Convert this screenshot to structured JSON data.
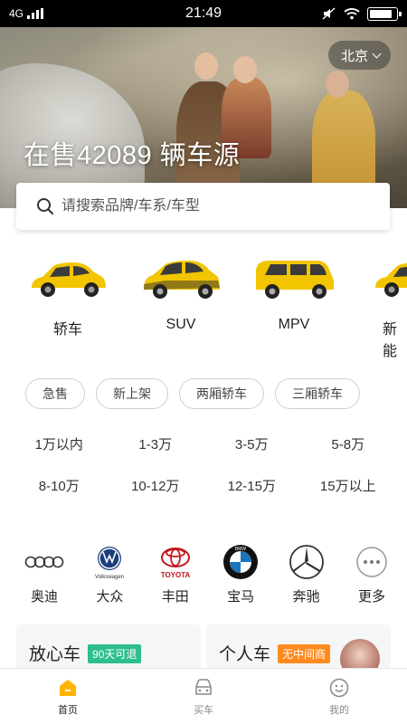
{
  "status_bar": {
    "network": "4G",
    "time": "21:49"
  },
  "hero": {
    "title": "在售42089 辆车源",
    "city": "北京"
  },
  "search": {
    "placeholder": "请搜索品牌/车系/车型"
  },
  "car_types": [
    {
      "label": "轿车",
      "color": "#f2c500"
    },
    {
      "label": "SUV",
      "color": "#f2c500"
    },
    {
      "label": "MPV",
      "color": "#f2c500"
    },
    {
      "label": "新能",
      "color": "#f2c500"
    }
  ],
  "tags": [
    "急售",
    "新上架",
    "两厢轿车",
    "三厢轿车"
  ],
  "price_ranges": [
    "1万以内",
    "1-3万",
    "3-5万",
    "5-8万",
    "8-10万",
    "10-12万",
    "12-15万",
    "15万以上"
  ],
  "brands": [
    {
      "label": "奥迪",
      "icon": "audi-logo-icon"
    },
    {
      "label": "大众",
      "icon": "volkswagen-logo-icon",
      "caption": "Volkswagen"
    },
    {
      "label": "丰田",
      "icon": "toyota-logo-icon",
      "caption": "TOYOTA"
    },
    {
      "label": "宝马",
      "icon": "bmw-logo-icon",
      "caption": "BMW"
    },
    {
      "label": "奔驰",
      "icon": "mercedes-logo-icon"
    },
    {
      "label": "更多",
      "icon": "more-icon"
    }
  ],
  "promos": [
    {
      "title": "放心车",
      "badge": "90天可退",
      "badge_color": "#2ebd8e"
    },
    {
      "title": "个人车",
      "badge": "无中间商",
      "badge_color": "#ff8a1f"
    }
  ],
  "tabbar": [
    {
      "label": "首页",
      "icon": "home-icon",
      "active": true
    },
    {
      "label": "买车",
      "icon": "car-icon",
      "active": false
    },
    {
      "label": "我的",
      "icon": "profile-icon",
      "active": false
    }
  ],
  "colors": {
    "accent": "#ffb400",
    "green_badge": "#2ebd8e",
    "orange_badge": "#ff8a1f"
  }
}
